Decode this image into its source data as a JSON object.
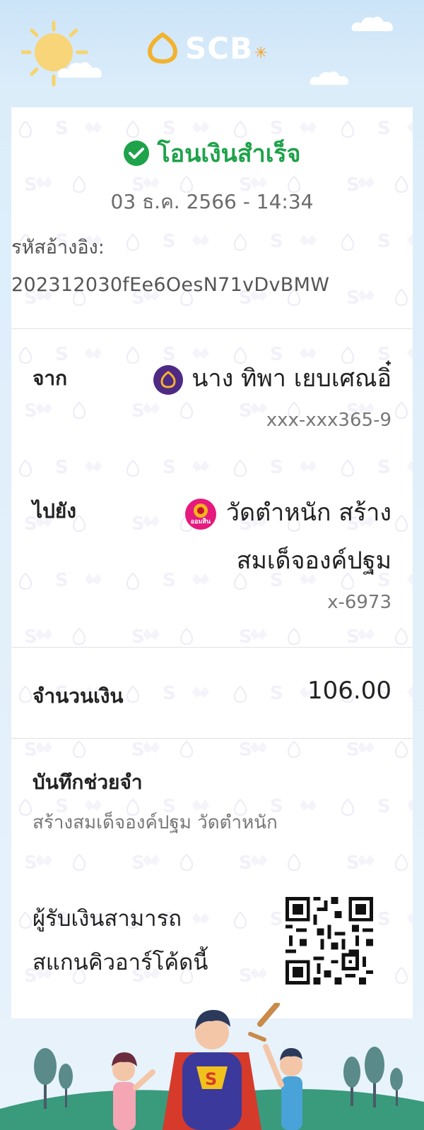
{
  "header": {
    "logo_text": "SCB",
    "brand_color": "#4e2a84",
    "accent_color": "#f3a024",
    "logo_icon": "scb-lotus-icon"
  },
  "status": {
    "icon": "check-circle-icon",
    "text": "โอนเงินสำเร็จ",
    "color": "#1ea24a"
  },
  "transaction": {
    "datetime": "03 ธ.ค. 2566 - 14:34",
    "ref_label": "รหัสอ้างอิง:",
    "ref_value": "202312030fEe6OesN71vDvBMW"
  },
  "from": {
    "label": "จาก",
    "bank_icon": "scb-bank-icon",
    "name": "นาง ทิพา เยบเศณอิ๋",
    "account": "xxx-xxx365-9"
  },
  "to": {
    "label": "ไปยัง",
    "bank_icon": "gsb-bank-icon",
    "bank_icon_text": "ออมสิน",
    "name_line1": "วัดตำหนัก สร้าง",
    "name_line2": "สมเด็จองค์ปฐม",
    "account": "x-6973"
  },
  "amount": {
    "label": "จำนวนเงิน",
    "value": "106.00"
  },
  "note": {
    "label": "บันทึกช่วยจำ",
    "value": "สร้างสมเด็จองค์ปฐม วัดตำหนัก"
  },
  "qr": {
    "text_line1": "ผู้รับเงินสามารถ",
    "text_line2": "สแกนคิวอาร์โค้ดนี้"
  }
}
